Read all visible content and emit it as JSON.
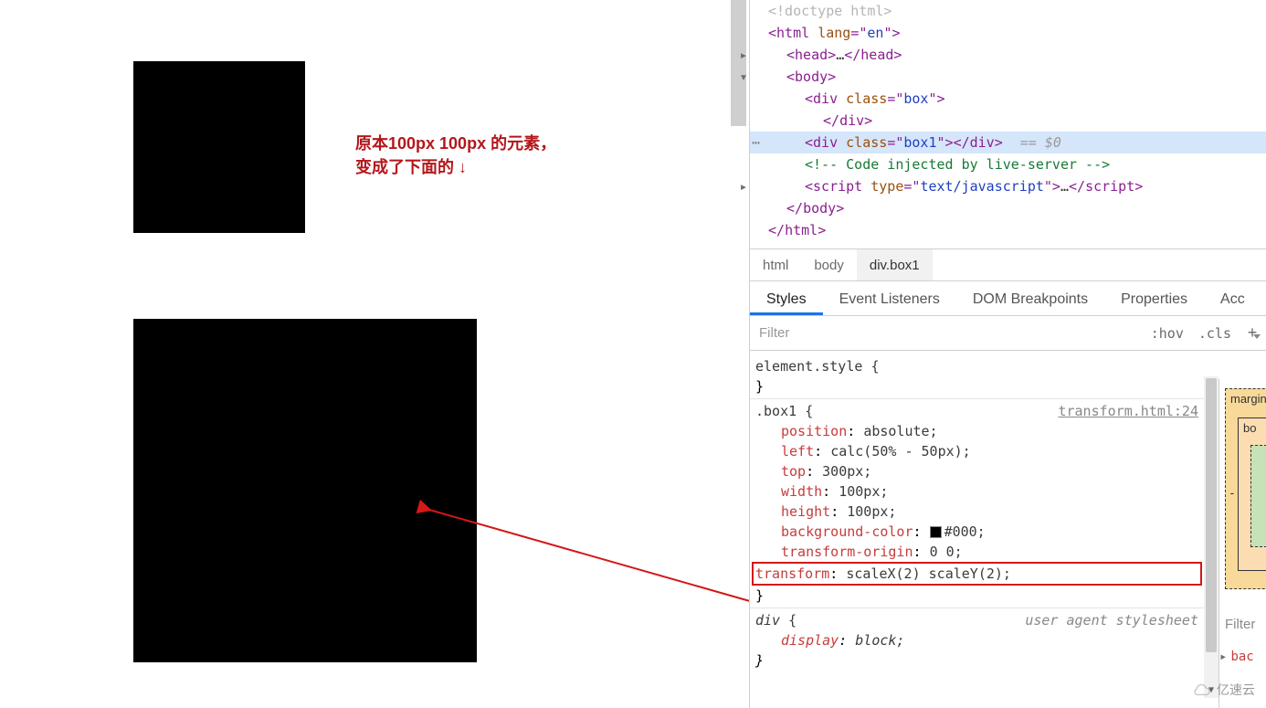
{
  "annotation": {
    "line1": "原本100px 100px 的元素，",
    "line2": "变成了下面的 ↓"
  },
  "dom": {
    "doctype": "<!doctype html>",
    "html_open_tag": "html",
    "html_lang_attr": "lang",
    "html_lang_val": "en",
    "head_tag": "head",
    "head_ellipsis": "…",
    "body_tag": "body",
    "div_tag": "div",
    "class_attr": "class",
    "box_class": "box",
    "box1_class": "box1",
    "dollar0": "== $0",
    "comment": "<!-- Code injected by live-server -->",
    "script_tag": "script",
    "type_attr": "type",
    "script_type_val": "text/javascript",
    "script_ellipsis": "…",
    "close_body": "body",
    "close_html": "html"
  },
  "crumbs": {
    "html": "html",
    "body": "body",
    "box1": "div.box1"
  },
  "subtabs": {
    "styles": "Styles",
    "listeners": "Event Listeners",
    "dom_bp": "DOM Breakpoints",
    "props": "Properties",
    "acc": "Acc"
  },
  "filter": {
    "placeholder": "Filter",
    "hov": ":hov",
    "cls": ".cls",
    "plus": "+"
  },
  "rules": {
    "element_style_selector": "element.style",
    "brace_open": "{",
    "brace_close": "}",
    "box1_selector": ".box1",
    "box1_source": "transform.html:24",
    "decls": [
      {
        "prop": "position",
        "val": "absolute;"
      },
      {
        "prop": "left",
        "val": "calc(50% - 50px);"
      },
      {
        "prop": "top",
        "val": "300px;"
      },
      {
        "prop": "width",
        "val": "100px;"
      },
      {
        "prop": "height",
        "val": "100px;"
      },
      {
        "prop": "background-color",
        "val": "#000;",
        "swatch": "#000"
      },
      {
        "prop": "transform-origin",
        "val": "0 0;"
      },
      {
        "prop": "transform",
        "val": "scaleX(2) scaleY(2);",
        "highlight": true
      }
    ],
    "ua_selector": "div",
    "ua_source": "user agent stylesheet",
    "ua_decls": [
      {
        "prop": "display",
        "val": "block;"
      }
    ]
  },
  "computed": {
    "margin_label": "margin",
    "border_label": "bo",
    "tick": "-",
    "filter_label": "Filter",
    "first_prop_tri": "▸",
    "first_prop": "bac"
  },
  "watermark": "亿速云"
}
